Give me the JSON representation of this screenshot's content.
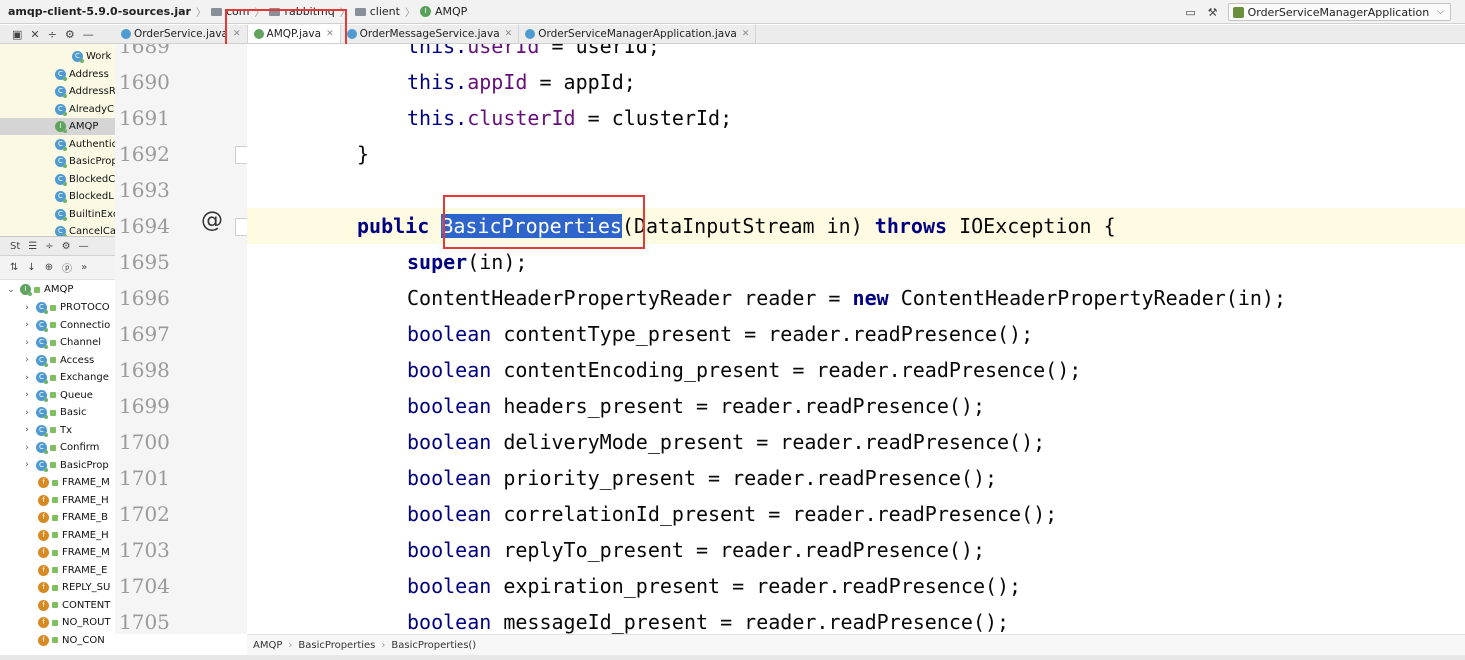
{
  "navbar": {
    "jar": "amqp-client-5.9.0-sources.jar",
    "crumbs": [
      "com",
      "rabbitmq",
      "client",
      "AMQP"
    ],
    "run_config": "OrderServiceManagerApplication"
  },
  "project_tree": {
    "items": [
      {
        "label": "Work",
        "kind": "class"
      },
      {
        "label": "Address",
        "kind": "class"
      },
      {
        "label": "AddressR",
        "kind": "class"
      },
      {
        "label": "AlreadyC",
        "kind": "class"
      },
      {
        "label": "AMQP",
        "kind": "interface",
        "selected": true
      },
      {
        "label": "Authentic",
        "kind": "class"
      },
      {
        "label": "BasicProp",
        "kind": "class"
      },
      {
        "label": "BlockedC",
        "kind": "class"
      },
      {
        "label": "BlockedL",
        "kind": "class"
      },
      {
        "label": "BuiltinExc",
        "kind": "class"
      },
      {
        "label": "CancelCa",
        "kind": "class"
      }
    ]
  },
  "structure": {
    "toolbar_label": "St",
    "root": "AMQP",
    "items": [
      {
        "label": "PROTOCO",
        "kind": "class",
        "expandable": true
      },
      {
        "label": "Connectio",
        "kind": "class",
        "expandable": true
      },
      {
        "label": "Channel",
        "kind": "class",
        "expandable": true
      },
      {
        "label": "Access",
        "kind": "class",
        "expandable": true
      },
      {
        "label": "Exchange",
        "kind": "class",
        "expandable": true
      },
      {
        "label": "Queue",
        "kind": "class",
        "expandable": true
      },
      {
        "label": "Basic",
        "kind": "class",
        "expandable": true
      },
      {
        "label": "Tx",
        "kind": "class",
        "expandable": true
      },
      {
        "label": "Confirm",
        "kind": "class",
        "expandable": true
      },
      {
        "label": "BasicProp",
        "kind": "class",
        "expandable": true
      },
      {
        "label": "FRAME_M",
        "kind": "field"
      },
      {
        "label": "FRAME_H",
        "kind": "field"
      },
      {
        "label": "FRAME_B",
        "kind": "field"
      },
      {
        "label": "FRAME_H",
        "kind": "field"
      },
      {
        "label": "FRAME_M",
        "kind": "field"
      },
      {
        "label": "FRAME_E",
        "kind": "field"
      },
      {
        "label": "REPLY_SU",
        "kind": "field"
      },
      {
        "label": "CONTENT",
        "kind": "field"
      },
      {
        "label": "NO_ROUT",
        "kind": "field"
      },
      {
        "label": "NO_CON",
        "kind": "field"
      }
    ]
  },
  "tabs": [
    {
      "label": "OrderService.java",
      "active": false
    },
    {
      "label": "AMQP.java",
      "active": true
    },
    {
      "label": "OrderMessageService.java",
      "active": false
    },
    {
      "label": "OrderServiceManagerApplication.java",
      "active": false
    }
  ],
  "editor": {
    "line_numbers": [
      "1689",
      "1690",
      "1691",
      "1692",
      "1693",
      "1694",
      "1695",
      "1696",
      "1697",
      "1698",
      "1699",
      "1700",
      "1701",
      "1702",
      "1703",
      "1704",
      "1705"
    ],
    "lines": {
      "l1689": {
        "kw": "this.",
        "field": "userId",
        "rest": " = userId;"
      },
      "l1690": {
        "kw": "this.",
        "field": "appId",
        "rest": " = appId;"
      },
      "l1691": {
        "kw": "this.",
        "field": "clusterId",
        "rest": " = clusterId;"
      },
      "l1692": {
        "text": "}"
      },
      "l1694": {
        "kw": "public ",
        "selected": "BasicProperties",
        "rest1": "(DataInputStream in) ",
        "kw2": "throws",
        "rest2": " IOException {"
      },
      "l1695": {
        "kw": "super",
        "rest": "(in);"
      },
      "l1696": {
        "a": "ContentHeaderPropertyReader reader = ",
        "kw": "new",
        "b": " ContentHeaderPropertyReader(in);"
      },
      "presence": [
        {
          "kw": "boolean",
          "rest": " contentType_present = reader.readPresence();"
        },
        {
          "kw": "boolean",
          "rest": " contentEncoding_present = reader.readPresence();"
        },
        {
          "kw": "boolean",
          "rest": " headers_present = reader.readPresence();"
        },
        {
          "kw": "boolean",
          "rest": " deliveryMode_present = reader.readPresence();"
        },
        {
          "kw": "boolean",
          "rest": " priority_present = reader.readPresence();"
        },
        {
          "kw": "boolean",
          "rest": " correlationId_present = reader.readPresence();"
        },
        {
          "kw": "boolean",
          "rest": " replyTo_present = reader.readPresence();"
        },
        {
          "kw": "boolean",
          "rest": " expiration_present = reader.readPresence();"
        },
        {
          "kw": "boolean",
          "rest": " messageId_present = reader.readPresence();"
        }
      ]
    },
    "gutter_annotation": "@"
  },
  "breadcrumb_bottom": [
    "AMQP",
    "BasicProperties",
    "BasicProperties()"
  ]
}
